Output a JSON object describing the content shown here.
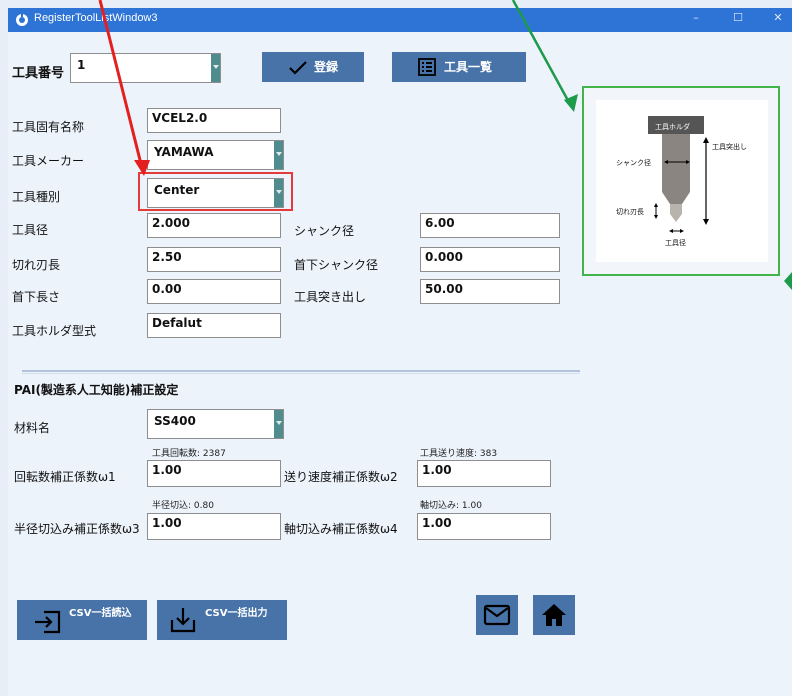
{
  "window": {
    "title": "RegisterToolListWindow3",
    "controls": {
      "minimize": "–",
      "maximize": "☐",
      "close": "✕"
    }
  },
  "header": {
    "tool_no_label": "工具番号",
    "tool_no_value": "1",
    "register_label": "登録",
    "list_label": "工具一覧"
  },
  "tool": {
    "unique_name": {
      "label": "工具固有名称",
      "value": "VCEL2.0"
    },
    "maker": {
      "label": "工具メーカー",
      "value": "YAMAWA"
    },
    "type": {
      "label": "工具種別",
      "value": "Center"
    },
    "diameter": {
      "label": "工具径",
      "value": "2.000"
    },
    "shank_diameter": {
      "label": "シャンク径",
      "value": "6.00"
    },
    "cutting_length": {
      "label": "切れ刃長",
      "value": "2.50"
    },
    "neck_shank_diameter": {
      "label": "首下シャンク径",
      "value": "0.000"
    },
    "neck_length": {
      "label": "首下長さ",
      "value": "0.00"
    },
    "protrusion": {
      "label": "工具突き出し",
      "value": "50.00"
    },
    "holder_type": {
      "label": "工具ホルダ型式",
      "value": "Defalut"
    }
  },
  "diagram": {
    "holder": "工具ホルダ",
    "protrusion": "工具突出し",
    "shank": "シャンク径",
    "cutting": "切れ刃長",
    "diameter": "工具径"
  },
  "pai": {
    "title": "PAI(製造系人工知能)補正設定",
    "material": {
      "label": "材料名",
      "value": "SS400"
    },
    "spindle_info": "工具回転数: 2387",
    "feed_info": "工具送り速度: 383",
    "w1": {
      "label": "回転数補正係数ω1",
      "value": "1.00"
    },
    "w2": {
      "label": "送り速度補正係数ω2",
      "value": "1.00"
    },
    "radial_info": "半径切込: 0.80",
    "axial_info": "軸切込み: 1.00",
    "w3": {
      "label": "半径切込み補正係数ω3",
      "value": "1.00"
    },
    "w4": {
      "label": "軸切込み補正係数ω4",
      "value": "1.00"
    }
  },
  "footer": {
    "csv_import": "CSV一括読込",
    "csv_export": "CSV一括出力"
  },
  "colors": {
    "titlebar": "#2e73d6",
    "button": "#4773a8",
    "highlight_red": "#e43a3a",
    "highlight_green": "#43b44a"
  }
}
